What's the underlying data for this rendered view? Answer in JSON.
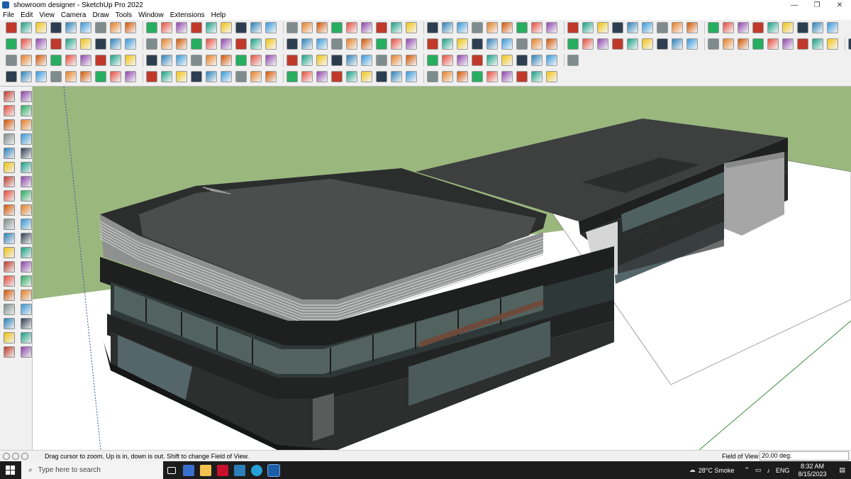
{
  "window": {
    "title": "showroom designer - SketchUp Pro 2022",
    "minimize": "—",
    "maximize": "❐",
    "close": "✕"
  },
  "menu": [
    "File",
    "Edit",
    "View",
    "Camera",
    "Draw",
    "Tools",
    "Window",
    "Extensions",
    "Help"
  ],
  "toolbar_rows": [
    {
      "count": 54
    },
    {
      "count": 56
    },
    {
      "count": 37
    },
    {
      "count": 36
    }
  ],
  "left_toolbar": {
    "count": 38
  },
  "status": {
    "message": "Drag cursor to zoom.  Up is in, down is out. Shift to change Field of View.",
    "vcb_label": "Field of View",
    "vcb_value": "20.00 deg."
  },
  "taskbar": {
    "search_placeholder": "Type here to search",
    "weather": "28°C  Smoke",
    "language": "ENG",
    "time": "8:32 AM",
    "date": "8/15/2023"
  },
  "colors": {
    "sky": "#9ab77e",
    "ground": "#ffffff",
    "building_dark": "#2b2c2c",
    "roof": "#4a4b4b",
    "glass": "#4f5f5f",
    "taskbar": "#1c1c1c"
  }
}
